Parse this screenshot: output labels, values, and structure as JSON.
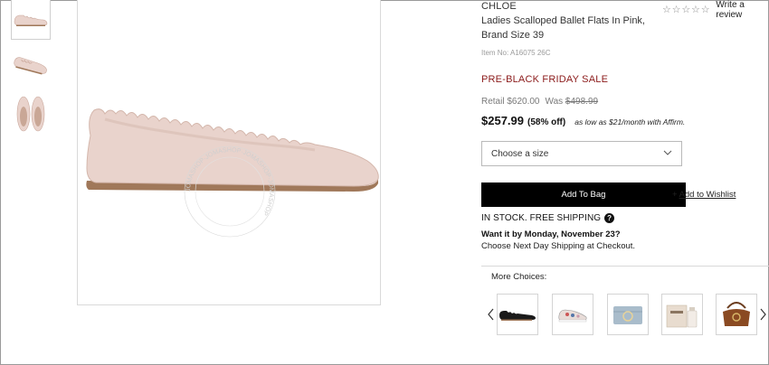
{
  "product": {
    "brand": "CHLOE",
    "title": "Ladies Scalloped Ballet Flats In Pink, Brand Size 39",
    "item_no": "Item No: A16075 26C",
    "watermark": "JOMASHOP·JOMASHOP·JOMASHOP·JOMASHOP"
  },
  "rating": {
    "stars": 0,
    "max_stars": 5,
    "review_link": "Write a review",
    "star_glyph": "☆"
  },
  "pricing": {
    "sale_banner": "PRE-BLACK FRIDAY SALE",
    "retail": "Retail $620.00",
    "was_label": "Was",
    "was_price": "$498.99",
    "price": "$257.99",
    "discount": "(58% off)",
    "affirm": "as low as $21/month with Affirm."
  },
  "purchase": {
    "size_placeholder": "Choose a size",
    "add_to_bag": "Add To Bag",
    "wishlist_plus": "+",
    "wishlist": "Add to Wishlist"
  },
  "shipping": {
    "stock": "IN STOCK. FREE SHIPPING",
    "help_glyph": "?",
    "want_it": "Want it by Monday, November 23?",
    "next_day": "Choose Next Day Shipping at Checkout."
  },
  "more_choices": {
    "label": "More Choices:",
    "items": [
      {
        "kind": "black-scalloped-flat"
      },
      {
        "kind": "printed-sneaker"
      },
      {
        "kind": "blue-c-bag"
      },
      {
        "kind": "chloe-perfume-box"
      },
      {
        "kind": "brown-saddle-bag"
      }
    ]
  },
  "colors": {
    "accent_sale": "#8b1a1a",
    "button_bg": "#000000",
    "shoe_pink": "#e9d3cc",
    "sole_tan": "#a0785a"
  }
}
